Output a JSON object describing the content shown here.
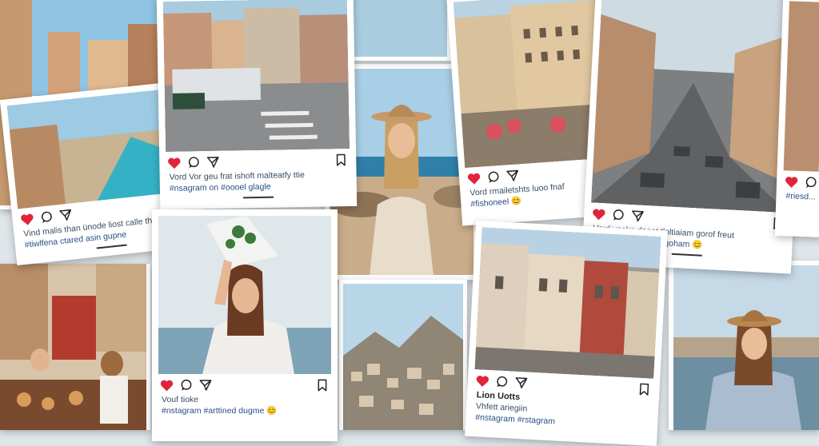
{
  "colors": {
    "heart": "#e0243c",
    "icon": "#222222",
    "hashtag": "#2a4f86"
  },
  "icons": [
    "heart-icon",
    "comment-icon",
    "share-icon",
    "bookmark-icon"
  ],
  "posts": [
    {
      "caption1": "Vind malis than ünode liost calle thef",
      "caption2": "#tiwlfena ctared asin gupne"
    },
    {
      "caption1": "Vord Vor geu frat ishoft malteatfy ttie",
      "caption2": "#nsagram on #oooel glagle"
    },
    {
      "caption1": "Vord rmailetshts luoo fnaf",
      "caption2": "#fishoneel 😊"
    },
    {
      "caption1": "Vord voake dooot tloltiaiam gorof freut",
      "caption2": "#nstagram #borekkgoham 😊"
    },
    {
      "caption1": "",
      "caption2": "#riesd..."
    },
    {
      "caption1": "Vouf tioke",
      "caption2": "#nstagram #arttined dugme 😊"
    },
    {
      "caption1": "Lion Uotts",
      "caption2": "Vhfett ariegiin",
      "caption3": "#nstagram #rstagram"
    }
  ]
}
